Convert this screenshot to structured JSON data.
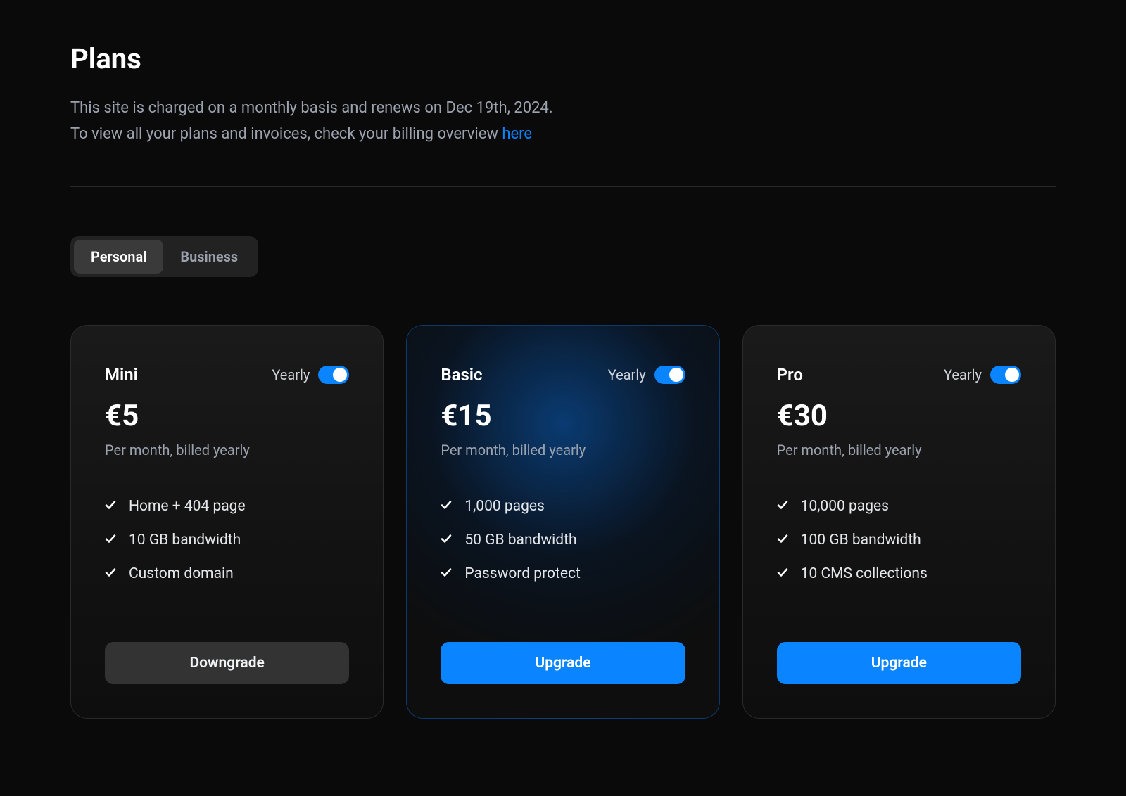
{
  "header": {
    "title": "Plans",
    "subtitle_line1": "This site is charged on a monthly basis and renews on Dec 19th, 2024.",
    "subtitle_line2_pre": "To view all your plans and invoices, check your billing overview ",
    "subtitle_link": "here"
  },
  "segmented": {
    "tabs": [
      {
        "label": "Personal",
        "active": true
      },
      {
        "label": "Business",
        "active": false
      }
    ]
  },
  "yearly_toggle_label": "Yearly",
  "plans": [
    {
      "name": "Mini",
      "price": "€5",
      "period": "Per month, billed yearly",
      "features": [
        "Home + 404 page",
        "10 GB bandwidth",
        "Custom domain"
      ],
      "action_label": "Downgrade",
      "action_style": "secondary",
      "highlight": false
    },
    {
      "name": "Basic",
      "price": "€15",
      "period": "Per month, billed yearly",
      "features": [
        "1,000 pages",
        "50 GB bandwidth",
        "Password protect"
      ],
      "action_label": "Upgrade",
      "action_style": "primary",
      "highlight": true
    },
    {
      "name": "Pro",
      "price": "€30",
      "period": "Per month, billed yearly",
      "features": [
        "10,000 pages",
        "100 GB bandwidth",
        "10 CMS collections"
      ],
      "action_label": "Upgrade",
      "action_style": "primary",
      "highlight": false
    }
  ]
}
